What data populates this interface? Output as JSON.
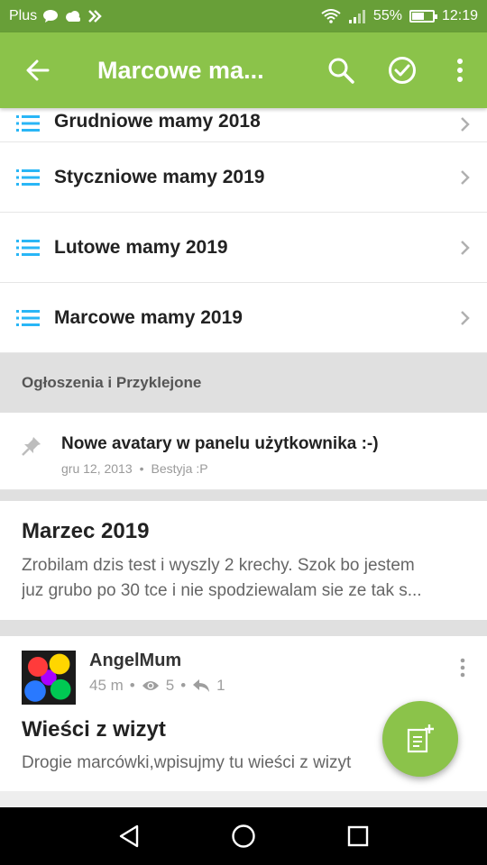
{
  "status_bar": {
    "carrier": "Plus",
    "battery_percent": "55%",
    "battery_level": 0.55,
    "time": "12:19"
  },
  "toolbar": {
    "title": "Marcowe ma...",
    "back_icon": "arrow-left-icon",
    "search_icon": "search-icon",
    "mark_read_icon": "check-circle-icon",
    "menu_icon": "more-vertical-icon"
  },
  "subforums": [
    {
      "label": "Grudniowe mamy 2018"
    },
    {
      "label": "Styczniowe mamy 2019"
    },
    {
      "label": "Lutowe mamy 2019"
    },
    {
      "label": "Marcowe mamy 2019"
    }
  ],
  "sticky_section": {
    "header": "Ogłoszenia i Przyklejone",
    "topic": {
      "title": "Nowe avatary w panelu użytkownika :-)",
      "date": "gru 12, 2013",
      "separator": "•",
      "author": "Bestyja :P"
    }
  },
  "topics": [
    {
      "title": "Marzec 2019",
      "excerpt_line1": "Zrobilam dzis test i wyszly 2 krechy. Szok bo jestem",
      "excerpt_line2": "juz grubo po 30 tce i nie spodziewalam sie ze tak s..."
    }
  ],
  "post": {
    "author": "AngelMum",
    "time": "45 m",
    "dot": "•",
    "views": "5",
    "replies": "1",
    "title": "Wieści z wizyt",
    "excerpt": "Drogie marcówki,wpisujmy tu wieści z wizyt"
  },
  "colors": {
    "primary": "#8bc34a",
    "primary_dark": "#689f38",
    "list_icon": "#29b6f6"
  }
}
